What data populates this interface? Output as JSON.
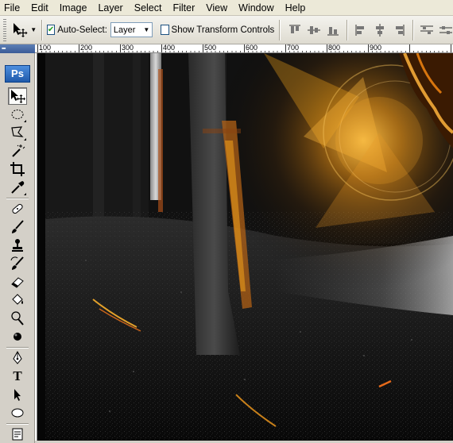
{
  "menubar": {
    "items": [
      "File",
      "Edit",
      "Image",
      "Layer",
      "Select",
      "Filter",
      "View",
      "Window",
      "Help"
    ]
  },
  "options": {
    "auto_select_label": "Auto-Select:",
    "auto_select_checked": true,
    "auto_select_value": "Layer",
    "show_transform_label": "Show Transform Controls",
    "show_transform_checked": false
  },
  "ruler": {
    "labels": [
      "100",
      "200",
      "300",
      "400",
      "500",
      "600",
      "700",
      "800",
      "900"
    ]
  },
  "toolbox": {
    "logo": "Ps",
    "active_tool": "move-tool",
    "type_tool_glyph": "T"
  },
  "colors": {
    "menubar_bg": "#ece9d8",
    "toolbox_bg": "#d4d0c8",
    "ps_logo_blue": "#2d6cc0",
    "canvas_dark": "#0a0a0a",
    "flare_orange": "#f2a31b"
  }
}
